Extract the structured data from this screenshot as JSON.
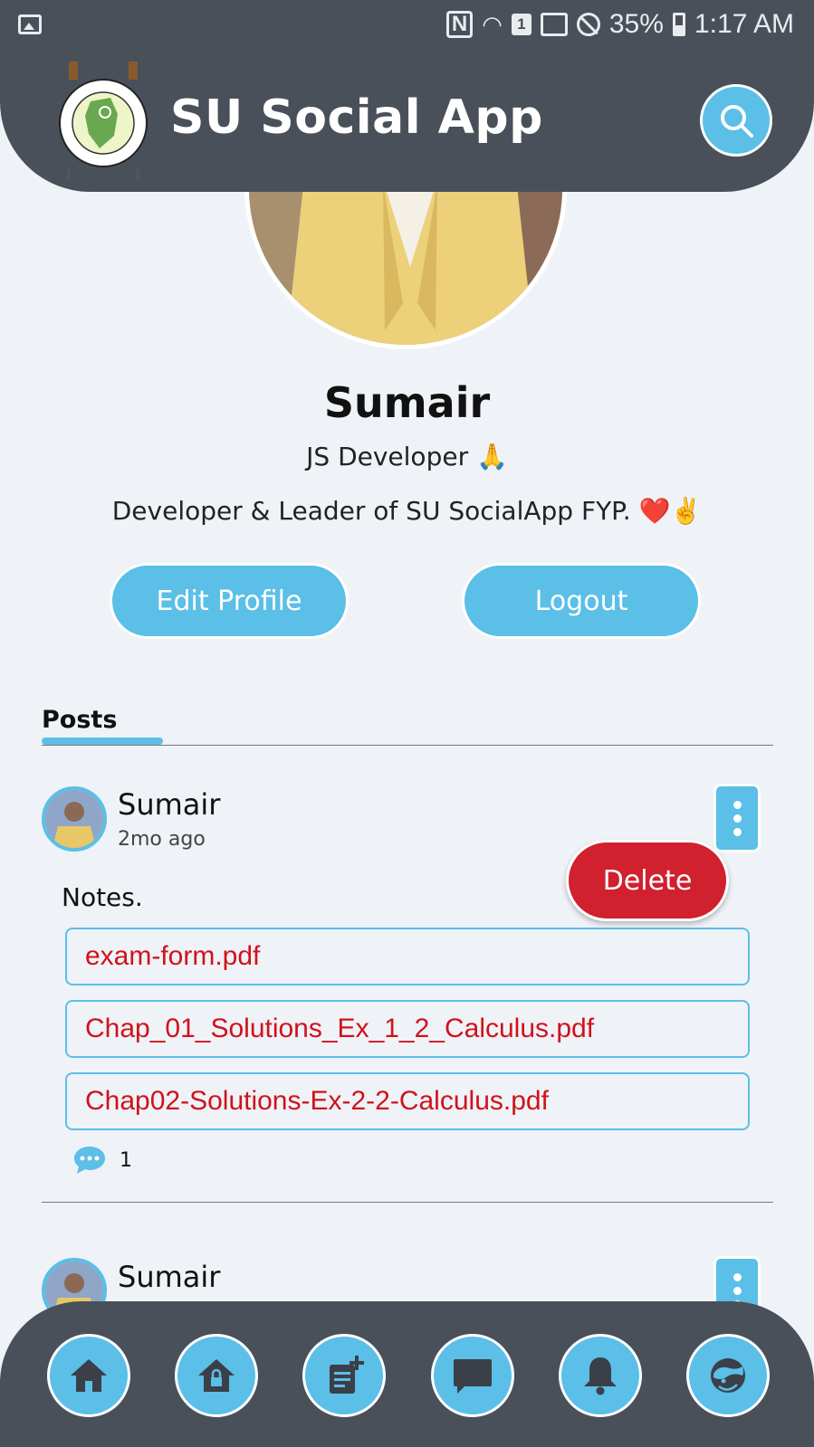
{
  "status_bar": {
    "battery": "35%",
    "time": "1:17 AM",
    "sim_badge": "1"
  },
  "header": {
    "title": "SU Social App",
    "logo": "university-of-sindh-logo"
  },
  "profile": {
    "name": "Sumair",
    "role": "JS Developer 🙏",
    "bio": "Developer & Leader of SU SocialApp FYP. ❤️✌️",
    "edit_label": "Edit Profile",
    "logout_label": "Logout"
  },
  "tabs": {
    "posts_label": "Posts"
  },
  "posts": [
    {
      "author": "Sumair",
      "time": "2mo ago",
      "text": "Notes.",
      "menu_action": "Delete",
      "files": [
        "exam-form.pdf",
        "Chap_01_Solutions_Ex_1_2_Calculus.pdf",
        "Chap02-Solutions-Ex-2-2-Calculus.pdf"
      ],
      "comments": "1"
    },
    {
      "author": "Sumair"
    }
  ],
  "nav": [
    "home-icon",
    "locked-home-icon",
    "new-post-icon",
    "chat-icon",
    "bell-icon",
    "profile-icon"
  ],
  "colors": {
    "header": "#4a505a",
    "accent": "#5bbfe7",
    "danger": "#d1202e",
    "background": "#eff2f7"
  }
}
